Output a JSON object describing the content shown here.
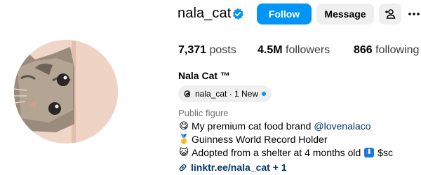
{
  "profile": {
    "username": "nala_cat",
    "verified_icon": "verified-badge-icon",
    "full_name": "Nala Cat ™"
  },
  "actions": {
    "follow_label": "Follow",
    "message_label": "Message",
    "add_user_icon": "add-user-icon",
    "more_icon": "more-options-icon"
  },
  "stats": {
    "posts_count": "7,371",
    "posts_label": "posts",
    "followers_count": "4.5M",
    "followers_label": "followers",
    "following_count": "866",
    "following_label": "following"
  },
  "threads": {
    "icon": "threads-icon",
    "label": "nala_cat · 1 New"
  },
  "bio": {
    "category": "Public figure",
    "line1_emoji": "😋",
    "line1_text": "My premium cat food brand",
    "line1_mention": "@lovenalaco",
    "line2_emoji": "🥇",
    "line2_text": "Guinness World Record Holder",
    "line3_emoji": "😺",
    "line3_text": "Adopted from a shelter at 4 months old",
    "line3_box": "⬇",
    "line3_suffix": "$sc",
    "link_icon": "link-icon",
    "link_text": "linktr.ee/nala_cat + 1"
  },
  "colors": {
    "accent": "#0095f6",
    "link": "#00376b",
    "secondary_text": "#737373",
    "button_gray": "#efefef"
  }
}
